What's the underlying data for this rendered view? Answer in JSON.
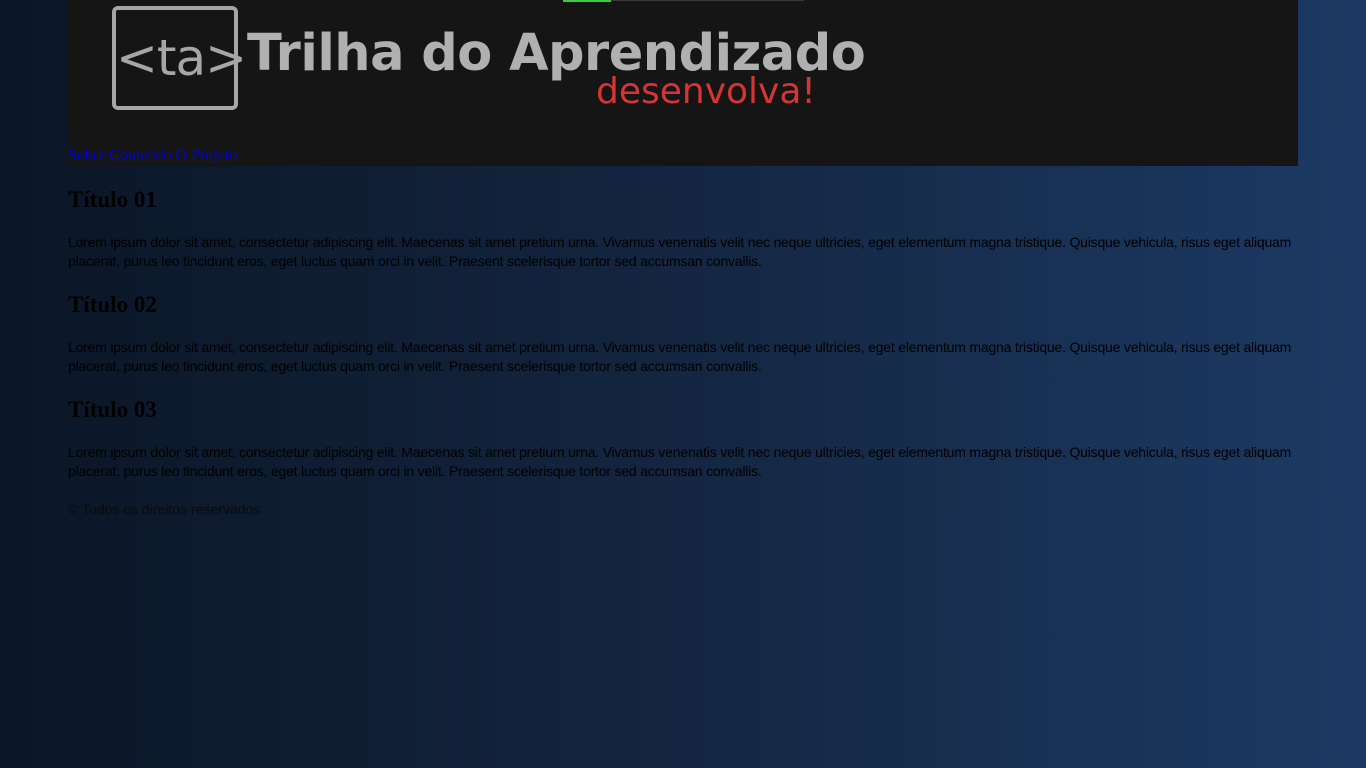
{
  "header": {
    "logo_text": "<ta>",
    "title": "Trilha do Aprendizado",
    "tagline": "desenvolva!",
    "progress_fraction": 0.2,
    "progress_color": "#39d039",
    "tagline_color": "#d43535",
    "background_color": "#151515"
  },
  "nav": {
    "items": [
      {
        "label": "Sobre"
      },
      {
        "label": "Conteúdo"
      },
      {
        "label": "O Projeto"
      }
    ]
  },
  "main": {
    "sections": [
      {
        "title": "Título 01",
        "body": "Lorem ipsum dolor sit amet, consectetur adipiscing elit. Maecenas sit amet pretium urna. Vivamus venenatis velit nec neque ultricies, eget elementum magna tristique. Quisque vehicula, risus eget aliquam placerat, purus leo tincidunt eros, eget luctus quam orci in velit. Praesent scelerisque tortor sed accumsan convallis."
      },
      {
        "title": "Título 02",
        "body": "Lorem ipsum dolor sit amet, consectetur adipiscing elit. Maecenas sit amet pretium urna. Vivamus venenatis velit nec neque ultricies, eget elementum magna tristique. Quisque vehicula, risus eget aliquam placerat, purus leo tincidunt eros, eget luctus quam orci in velit. Praesent scelerisque tortor sed accumsan convallis."
      },
      {
        "title": "Título 03",
        "body": "Lorem ipsum dolor sit amet, consectetur adipiscing elit. Maecenas sit amet pretium urna. Vivamus venenatis velit nec neque ultricies, eget elementum magna tristique. Quisque vehicula, risus eget aliquam placerat, purus leo tincidunt eros, eget luctus quam orci in velit. Praesent scelerisque tortor sed accumsan convallis."
      }
    ]
  },
  "footer": {
    "text": "© Todos os direitos reservados"
  }
}
